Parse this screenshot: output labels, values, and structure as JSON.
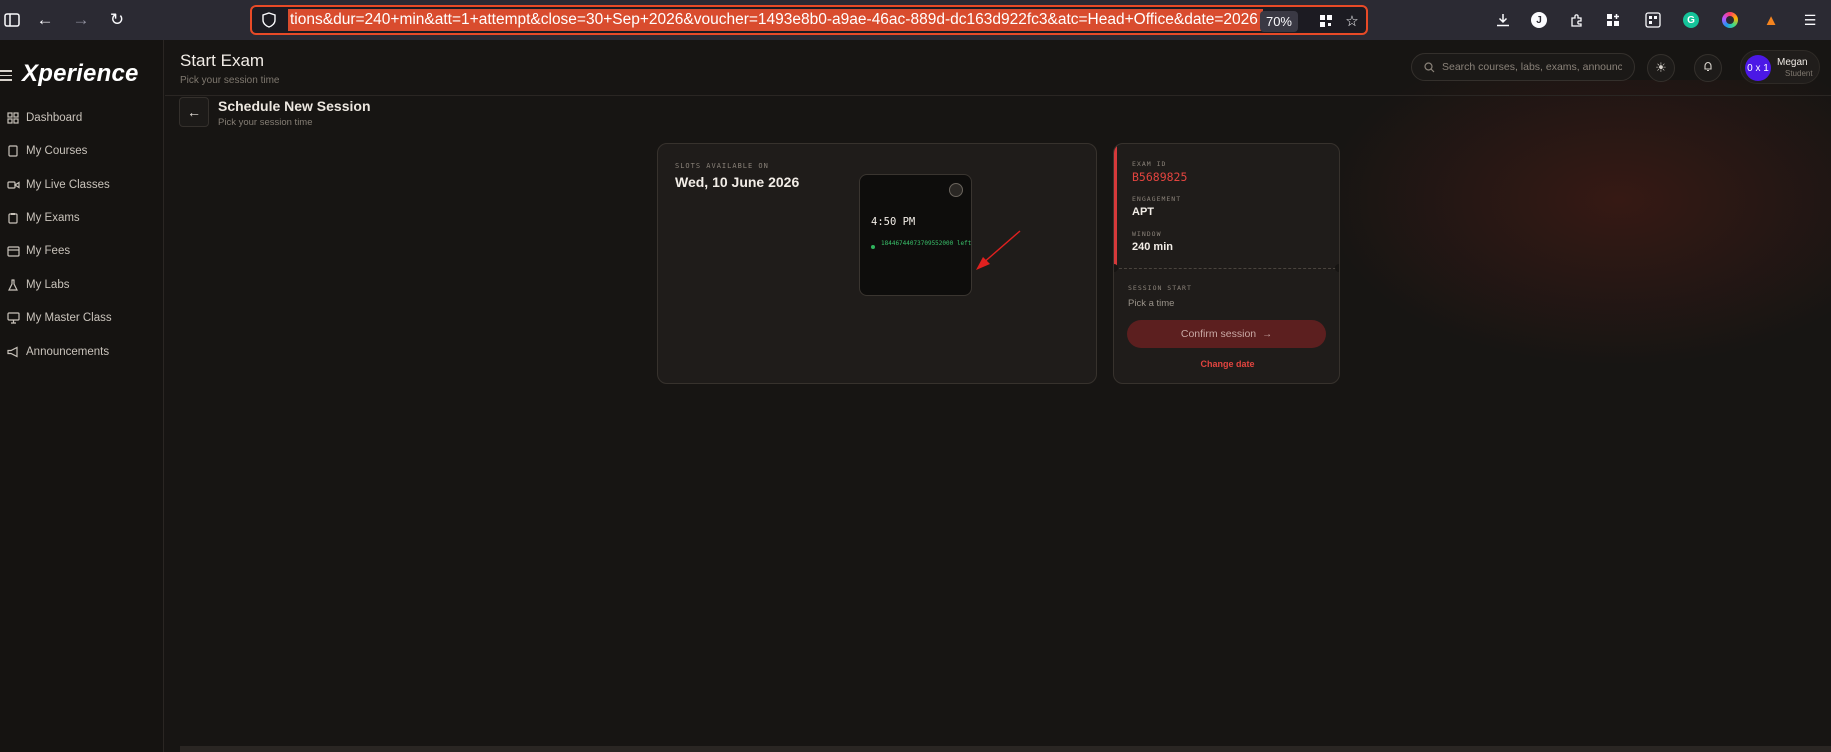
{
  "browser": {
    "url": "tions&dur=240+min&att=1+attempt&close=30+Sep+2026&voucher=1493e8b0-a9ae-46ac-889d-dc163d922fc3&atc=Head+Office&date=2026",
    "zoom": "70%"
  },
  "sidebar": {
    "logo_x": "X",
    "logo_rest": "perience",
    "items": [
      {
        "label": "Dashboard",
        "icon": "grid-icon"
      },
      {
        "label": "My Courses",
        "icon": "book-icon"
      },
      {
        "label": "My Live Classes",
        "icon": "video-icon"
      },
      {
        "label": "My Exams",
        "icon": "clipboard-icon"
      },
      {
        "label": "My Fees",
        "icon": "card-icon"
      },
      {
        "label": "My Labs",
        "icon": "flask-icon"
      },
      {
        "label": "My Master Class",
        "icon": "monitor-icon"
      },
      {
        "label": "Announcements",
        "icon": "megaphone-icon"
      }
    ]
  },
  "header": {
    "title": "Start Exam",
    "subtitle": "Pick your session time",
    "search_placeholder": "Search courses, labs, exams, announce",
    "user": {
      "avatar": "0 x 1",
      "name": "Megan",
      "role": "Student"
    }
  },
  "schedule": {
    "title": "Schedule New Session",
    "subtitle": "Pick your session time"
  },
  "slots": {
    "label": "SLOTS AVAILABLE ON",
    "date": "Wed, 10 June 2026",
    "slot": {
      "time": "4:50 PM",
      "left": "18446744073709552000 left"
    }
  },
  "info": {
    "exam_id_label": "EXAM ID",
    "exam_id": "B5689825",
    "engagement_label": "ENGAGEMENT",
    "engagement": "APT",
    "window_label": "WINDOW",
    "window": "240 min",
    "session_start_label": "SESSION START",
    "session_start": "Pick a time",
    "confirm_label": "Confirm session",
    "change_date_label": "Change date"
  },
  "colors": {
    "accent": "#e2443f",
    "url_highlight": "#d94c2e",
    "slot_green": "#39c06a",
    "avatar": "#4b18e6"
  }
}
